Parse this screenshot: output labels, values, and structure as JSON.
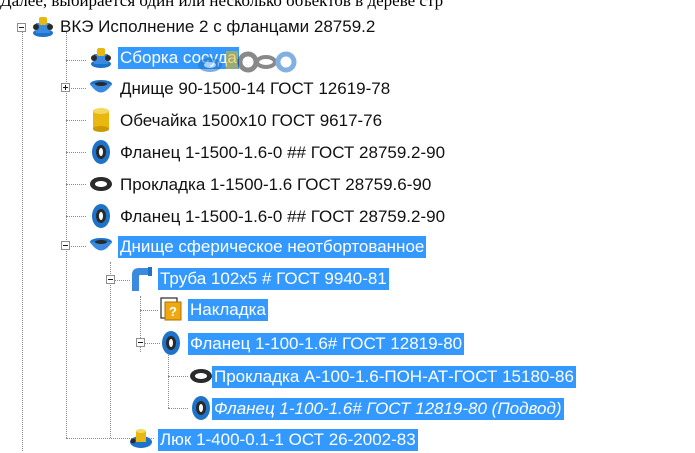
{
  "caption": "Далее, выбирается один или несколько объектов в дереве стр",
  "tree": {
    "root": {
      "label": "ВКЭ Исполнение 2 с фланцами 28759.2",
      "icon": "assembly-icon"
    },
    "items": [
      {
        "label": "Сборка сосуда",
        "icon": "assembly-icon",
        "selected": true
      },
      {
        "label": "Днище 90-1500-14 ГОСТ 12619-78",
        "icon": "head-icon",
        "selected": false,
        "collapsed": true
      },
      {
        "label": "Обечайка 1500х10 ГОСТ 9617-76",
        "icon": "shell-icon",
        "selected": false
      },
      {
        "label": "Фланец 1-1500-1.6-0 ## ГОСТ 28759.2-90",
        "icon": "flange-icon",
        "selected": false
      },
      {
        "label": "Прокладка 1-1500-1.6 ГОСТ 28759.6-90",
        "icon": "gasket-icon",
        "selected": false
      },
      {
        "label": "Фланец 1-1500-1.6-0 ## ГОСТ 28759.2-90",
        "icon": "flange-icon",
        "selected": false
      },
      {
        "label": "Днище сферическое неотбортованное",
        "icon": "head-icon",
        "selected": true
      },
      {
        "label": "Труба 102х5 # ГОСТ 9940-81",
        "icon": "pipe-icon",
        "selected": true
      },
      {
        "label": "Накладка",
        "icon": "unknown-part-icon",
        "selected": true
      },
      {
        "label": "Фланец 1-100-1.6# ГОСТ 12819-80",
        "icon": "flange-icon",
        "selected": true
      },
      {
        "label": "Прокладка А-100-1.6-ПОН-АТ-ГОСТ 15180-86",
        "icon": "gasket-icon",
        "selected": true
      },
      {
        "label": "Фланец 1-100-1.6# ГОСТ 12819-80 (Подвод)",
        "icon": "flange-icon",
        "selected": true,
        "italic": true
      },
      {
        "label": "Люк 1-400-0.1-1 ОСТ 26-2002-83",
        "icon": "hatch-icon",
        "selected": true
      }
    ]
  },
  "colors": {
    "selection": "#3399ff",
    "icon_blue": "#1d73c9",
    "icon_dark": "#2a2a2a",
    "icon_yellow": "#e8b810"
  }
}
